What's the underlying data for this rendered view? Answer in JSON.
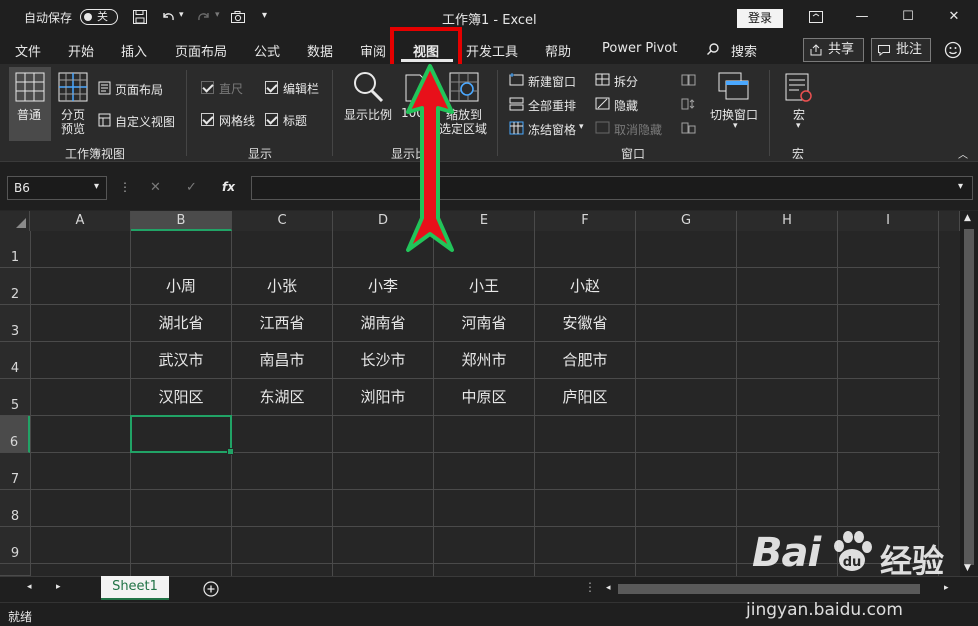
{
  "titlebar": {
    "autosave_label": "自动保存",
    "autosave_state": "关",
    "title": "工作簿1 - Excel",
    "login_label": "登录"
  },
  "tabs": [
    "文件",
    "开始",
    "插入",
    "页面布局",
    "公式",
    "数据",
    "审阅",
    "视图",
    "开发工具",
    "帮助",
    "Power Pivot"
  ],
  "active_tab": "视图",
  "search_label": "搜索",
  "share_label": "共享",
  "comment_label": "批注",
  "ribbon": {
    "workbook_views": {
      "group": "工作簿视图",
      "normal": "普通",
      "page_break_1": "分页",
      "page_break_2": "预览",
      "page_layout": "页面布局",
      "custom_views": "自定义视图"
    },
    "show": {
      "group": "显示",
      "ruler": "直尺",
      "formula_bar": "编辑栏",
      "gridlines": "网格线",
      "headings": "标题"
    },
    "zoom": {
      "group": "显示比例",
      "zoom": "显示比例",
      "hundred": "100%",
      "zoom_sel_1": "缩放到",
      "zoom_sel_2": "选定区域"
    },
    "window": {
      "group": "窗口",
      "new_window": "新建窗口",
      "arrange_all": "全部重排",
      "freeze_panes": "冻结窗格",
      "split": "拆分",
      "hide": "隐藏",
      "unhide": "取消隐藏",
      "switch_windows": "切换窗口"
    },
    "macros": {
      "group": "宏",
      "macros": "宏"
    }
  },
  "formula": {
    "name_box": "B6",
    "fx": "fx",
    "value": ""
  },
  "columns": [
    "A",
    "B",
    "C",
    "D",
    "E",
    "F",
    "G",
    "H",
    "I"
  ],
  "rows": [
    "1",
    "2",
    "3",
    "4",
    "5",
    "6",
    "7",
    "8",
    "9"
  ],
  "cells": [
    [
      "小周",
      "小张",
      "小李",
      "小王",
      "小赵"
    ],
    [
      "湖北省",
      "江西省",
      "湖南省",
      "河南省",
      "安徽省"
    ],
    [
      "武汉市",
      "南昌市",
      "长沙市",
      "郑州市",
      "合肥市"
    ],
    [
      "汉阳区",
      "东湖区",
      "浏阳市",
      "中原区",
      "庐阳区"
    ]
  ],
  "sheet_tab": "Sheet1",
  "status": "就绪",
  "watermark": {
    "brand": "Bai",
    "brand2": "经验",
    "url": "jingyan.baidu.com"
  },
  "colors": {
    "accent": "#21a366",
    "highlight": "#e50000",
    "arrow_fill": "#e8101a",
    "arrow_outline": "#22c45a"
  }
}
